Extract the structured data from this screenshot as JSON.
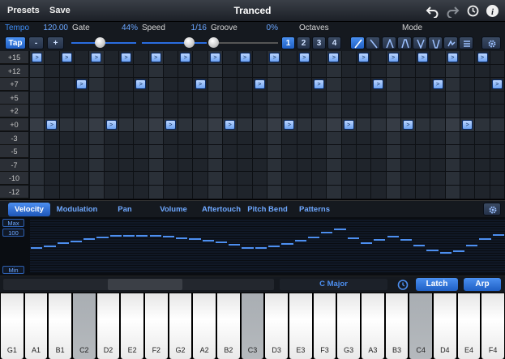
{
  "topbar": {
    "presets_label": "Presets",
    "save_label": "Save",
    "title": "Tranced",
    "icons": [
      "undo-icon",
      "redo-icon",
      "sync-icon",
      "info-icon"
    ]
  },
  "params": {
    "tempo_label": "Tempo",
    "tempo_value": "120.00",
    "gate_label": "Gate",
    "gate_value": "44%",
    "speed_label": "Speed",
    "speed_value": "1/16",
    "groove_label": "Groove",
    "groove_value": "0%",
    "octaves_label": "Octaves",
    "mode_label": "Mode"
  },
  "controls": {
    "tap_label": "Tap",
    "minus_label": "-",
    "plus_label": "+",
    "gate_level": 0.44,
    "speed_level": 0.72,
    "groove_level": 0.0,
    "octave_options": [
      "1",
      "2",
      "3",
      "4"
    ],
    "octave_selected": "1"
  },
  "grid": {
    "row_labels": [
      "+15",
      "+12",
      "+7",
      "+5",
      "+2",
      "+0",
      "-3",
      "-5",
      "-7",
      "-10",
      "-12"
    ],
    "notes": [
      {
        "step": 0,
        "row": 0
      },
      {
        "step": 1,
        "row": 5
      },
      {
        "step": 2,
        "row": 0
      },
      {
        "step": 3,
        "row": 2
      },
      {
        "step": 4,
        "row": 0
      },
      {
        "step": 5,
        "row": 5
      },
      {
        "step": 6,
        "row": 0
      },
      {
        "step": 7,
        "row": 2
      },
      {
        "step": 8,
        "row": 0
      },
      {
        "step": 9,
        "row": 5
      },
      {
        "step": 10,
        "row": 0
      },
      {
        "step": 11,
        "row": 2
      },
      {
        "step": 12,
        "row": 0
      },
      {
        "step": 13,
        "row": 5
      },
      {
        "step": 14,
        "row": 0
      },
      {
        "step": 15,
        "row": 2
      },
      {
        "step": 16,
        "row": 0
      },
      {
        "step": 17,
        "row": 5
      },
      {
        "step": 18,
        "row": 0
      },
      {
        "step": 19,
        "row": 2
      },
      {
        "step": 20,
        "row": 0
      },
      {
        "step": 21,
        "row": 5
      },
      {
        "step": 22,
        "row": 0
      },
      {
        "step": 23,
        "row": 2
      },
      {
        "step": 24,
        "row": 0
      },
      {
        "step": 25,
        "row": 5
      },
      {
        "step": 26,
        "row": 0
      },
      {
        "step": 27,
        "row": 2
      },
      {
        "step": 28,
        "row": 0
      },
      {
        "step": 29,
        "row": 5
      },
      {
        "step": 30,
        "row": 0
      },
      {
        "step": 31,
        "row": 2
      }
    ],
    "note_glyph": ">"
  },
  "tabs": {
    "items": [
      "Velocity",
      "Modulation",
      "Pan",
      "Volume",
      "Aftertouch",
      "Pitch Bend",
      "Patterns"
    ],
    "selected": "Velocity"
  },
  "velocity": {
    "max_label": "Max",
    "mid_label": "100",
    "min_label": "Min",
    "levels": [
      0.5,
      0.53,
      0.58,
      0.62,
      0.66,
      0.69,
      0.72,
      0.72,
      0.72,
      0.72,
      0.71,
      0.68,
      0.66,
      0.63,
      0.6,
      0.55,
      0.5,
      0.49,
      0.52,
      0.57,
      0.63,
      0.7,
      0.79,
      0.85,
      0.68,
      0.59,
      0.65,
      0.71,
      0.65,
      0.54,
      0.45,
      0.4,
      0.43,
      0.54,
      0.66,
      0.74
    ]
  },
  "status": {
    "scale": "C Major",
    "latch_label": "Latch",
    "arp_label": "Arp"
  },
  "keyboard": {
    "keys": [
      "G1",
      "A1",
      "B1",
      "C2",
      "D2",
      "E2",
      "F2",
      "G2",
      "A2",
      "B2",
      "C3",
      "D3",
      "E3",
      "F3",
      "G3",
      "A3",
      "B3",
      "C4",
      "D4",
      "E4",
      "F4"
    ],
    "dim_keys": [
      "C2",
      "C3",
      "C4"
    ]
  }
}
